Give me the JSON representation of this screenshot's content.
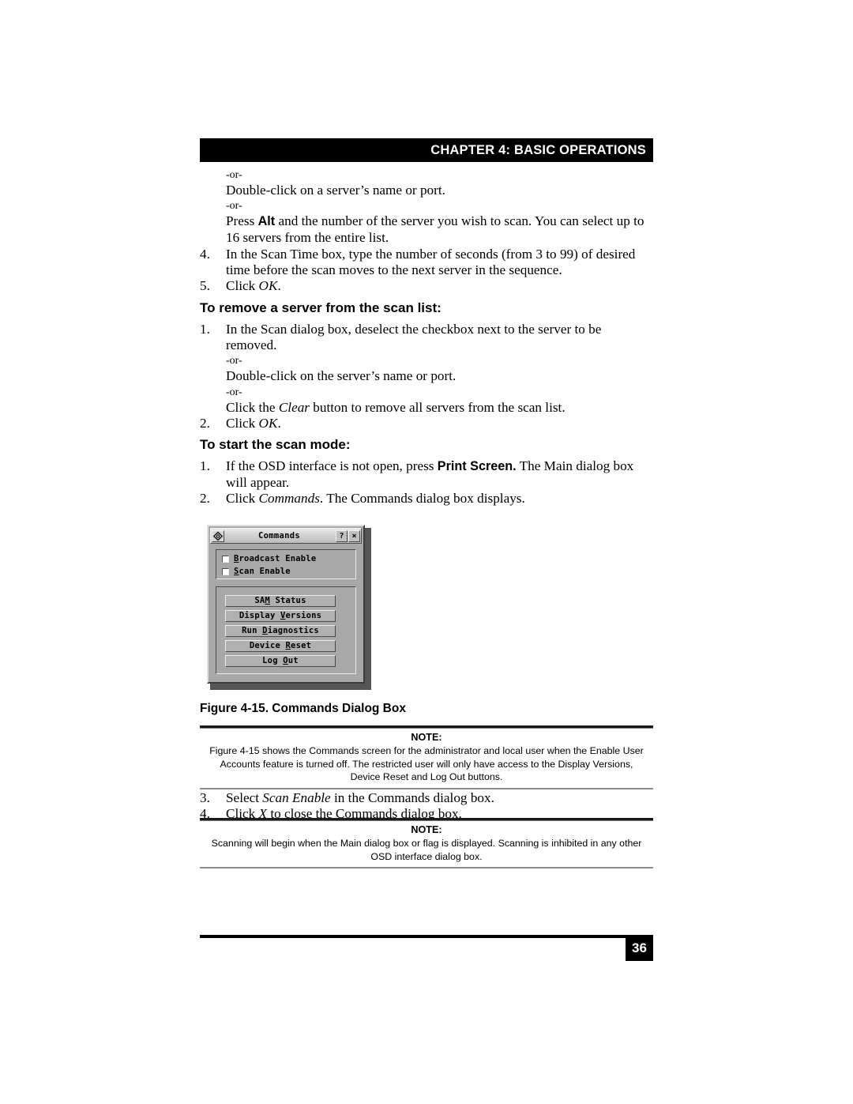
{
  "header": {
    "chapter_title": "CHAPTER 4: BASIC OPERATIONS"
  },
  "body": {
    "or_label_1": "-or-",
    "line_double_click_server": "Double-click on a server’s name or port.",
    "or_label_2": "-or-",
    "press_alt_prefix": "Press ",
    "press_alt_key": "Alt",
    "press_alt_rest": " and the number of the server you wish to scan. You can select up to 16 servers from the entire list.",
    "item4_num": "4.",
    "item4_text": "In the Scan Time box, type the number of seconds (from 3 to 99) of desired time before the scan moves to the next server in the sequence.",
    "item5_num": "5.",
    "item5_prefix": "Click ",
    "item5_italic": "OK",
    "item5_suffix": "."
  },
  "section_remove": {
    "heading": "To remove a server from the scan list:",
    "item1_num": "1.",
    "item1_text": "In the Scan dialog box, deselect the checkbox next to the server to be removed.",
    "or_label_1": "-or-",
    "line_double_click": "Double-click on the server’s name or port.",
    "or_label_2": "-or-",
    "clear_prefix": "Click the ",
    "clear_italic": "Clear",
    "clear_suffix": " button to remove all servers from the scan list.",
    "item2_num": "2.",
    "item2_prefix": "Click ",
    "item2_italic": "OK",
    "item2_suffix": "."
  },
  "section_start": {
    "heading": "To start the scan mode:",
    "item1_num": "1.",
    "item1_prefix": "If the OSD interface is not open, press ",
    "item1_bold": "Print Screen.",
    "item1_suffix": " The Main dialog box will appear.",
    "item2_num": "2.",
    "item2_prefix": "Click ",
    "item2_italic": "Commands",
    "item2_suffix": ". The Commands dialog box displays."
  },
  "dialog": {
    "title": "Commands",
    "sys_icon": "osd-logo-icon",
    "help_button": "?",
    "close_button": "×",
    "checkboxes": [
      {
        "mnemonic": "B",
        "label_rest": "roadcast Enable",
        "checked": false
      },
      {
        "mnemonic": "S",
        "label_rest": "can Enable",
        "checked": false
      }
    ],
    "buttons": [
      {
        "pre": "SA",
        "mnemonic": "M",
        "post": " Status"
      },
      {
        "pre": "Display ",
        "mnemonic": "V",
        "post": "ersions"
      },
      {
        "pre": "Run ",
        "mnemonic": "D",
        "post": "iagnostics"
      },
      {
        "pre": "Device ",
        "mnemonic": "R",
        "post": "eset"
      },
      {
        "pre": "Log ",
        "mnemonic": "O",
        "post": "ut"
      }
    ]
  },
  "figure": {
    "caption": "Figure 4-15.  Commands Dialog Box"
  },
  "note1": {
    "title": "NOTE:",
    "text": "Figure 4-15 shows the Commands screen for the administrator and local user when the Enable User Accounts feature is turned off. The restricted user will only have access to the Display Versions, Device Reset and Log Out buttons."
  },
  "mid_list": {
    "item3_num": "3.",
    "item3_prefix": "Select ",
    "item3_italic": "Scan Enable",
    "item3_suffix": " in the Commands dialog box.",
    "item4_num": "4.",
    "item4_prefix": "Click ",
    "item4_italic": "X",
    "item4_suffix": " to close the Commands dialog box."
  },
  "note2": {
    "title": "NOTE:",
    "text": "Scanning will begin when the Main dialog box or flag is displayed. Scanning is inhibited in any other OSD interface dialog box."
  },
  "footer": {
    "page_number": "36"
  }
}
